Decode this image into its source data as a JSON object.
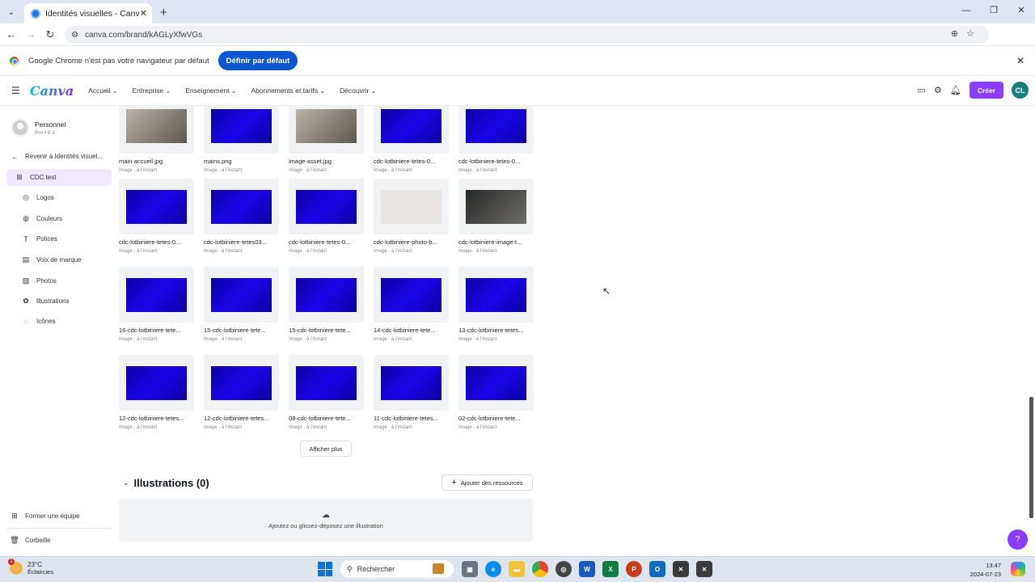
{
  "browser": {
    "tab_title": "Identités visuelles - Canva",
    "url": "canva.com/brand/kAGLyXfwVGs",
    "infobar_text": "Google Chrome n'est pas votre navigateur par défaut",
    "infobar_button": "Définir par défaut"
  },
  "canva_header": {
    "logo": "Canva",
    "menu": [
      "Accueil",
      "Entreprise",
      "Enseignement",
      "Abonnements et tarifs",
      "Découvrir"
    ],
    "create_label": "Créer",
    "avatar_initials": "CL"
  },
  "sidebar": {
    "profile_name": "Personnel",
    "profile_sub": "Pro • 8 1",
    "back_label": "Revenir à Identités visuel...",
    "items": [
      "CDC test",
      "Logos",
      "Couleurs",
      "Polices",
      "Voix de marque",
      "Photos",
      "Illustrations",
      "Icônes"
    ],
    "bottom": [
      "Former une équipe",
      "Corbeille"
    ]
  },
  "photos": [
    {
      "name": "main-accueil.jpg",
      "meta": "Image · à l'instant",
      "style": "photo"
    },
    {
      "name": "mains.png",
      "meta": "Image · à l'instant",
      "style": "blue"
    },
    {
      "name": "image-asset.jpg",
      "meta": "Image · à l'instant",
      "style": "photo"
    },
    {
      "name": "cdc-lotbiniere-tetes-0...",
      "meta": "Image · à l'instant",
      "style": "blue"
    },
    {
      "name": "cdc-lotbiniere-tetes-0...",
      "meta": "Image · à l'instant",
      "style": "blue"
    },
    {
      "name": "cdc-lotbiniere-tetes-0...",
      "meta": "Image · à l'instant",
      "style": "blue"
    },
    {
      "name": "cdc-lotbiniere-tetes03...",
      "meta": "Image · à l'instant",
      "style": "blue"
    },
    {
      "name": "cdc-lotbiniere-tetes-0...",
      "meta": "Image · à l'instant",
      "style": "blue"
    },
    {
      "name": "cdc-lotbiniere-photo-b...",
      "meta": "Image · à l'instant",
      "style": "faded"
    },
    {
      "name": "cdc-lotbiniere-image-t...",
      "meta": "Image · à l'instant",
      "style": "dark"
    },
    {
      "name": "16-cdc-lotbiniere-tete...",
      "meta": "Image · à l'instant",
      "style": "blue"
    },
    {
      "name": "15-cdc-lotbiniere-tete...",
      "meta": "Image · à l'instant",
      "style": "blue"
    },
    {
      "name": "15-cdc-lotbiniere-tete...",
      "meta": "Image · à l'instant",
      "style": "blue"
    },
    {
      "name": "14-cdc-lotbiniere-tete...",
      "meta": "Image · à l'instant",
      "style": "blue"
    },
    {
      "name": "13-cdc-lotbiniere-tetes...",
      "meta": "Image · à l'instant",
      "style": "blue"
    },
    {
      "name": "12-cdc-lotbiniere-tetes...",
      "meta": "Image · à l'instant",
      "style": "blue"
    },
    {
      "name": "12-cdc-lotbiniere-tetes...",
      "meta": "Image · à l'instant",
      "style": "blue"
    },
    {
      "name": "08-cdc-lotbiniere-tete...",
      "meta": "Image · à l'instant",
      "style": "blue"
    },
    {
      "name": "11-cdc-lotbiniere-tetes...",
      "meta": "Image · à l'instant",
      "style": "blue"
    },
    {
      "name": "02-cdc-lotbiniere-tete...",
      "meta": "Image · à l'instant",
      "style": "blue"
    }
  ],
  "show_more": "Afficher plus",
  "illustrations": {
    "title": "Illustrations (0)",
    "add_label": "Ajouter des ressources",
    "drop_text": "Ajoutez ou glissez-déposez une illustration"
  },
  "taskbar": {
    "temp": "23°C",
    "weather": "Éclaircies",
    "search": "Rechercher",
    "time": "13:47",
    "date": "2024-07-23"
  },
  "colors": {
    "accent": "#8b3dff",
    "chrome_blue": "#0b57d0",
    "blue_image": "#1a00e6"
  }
}
